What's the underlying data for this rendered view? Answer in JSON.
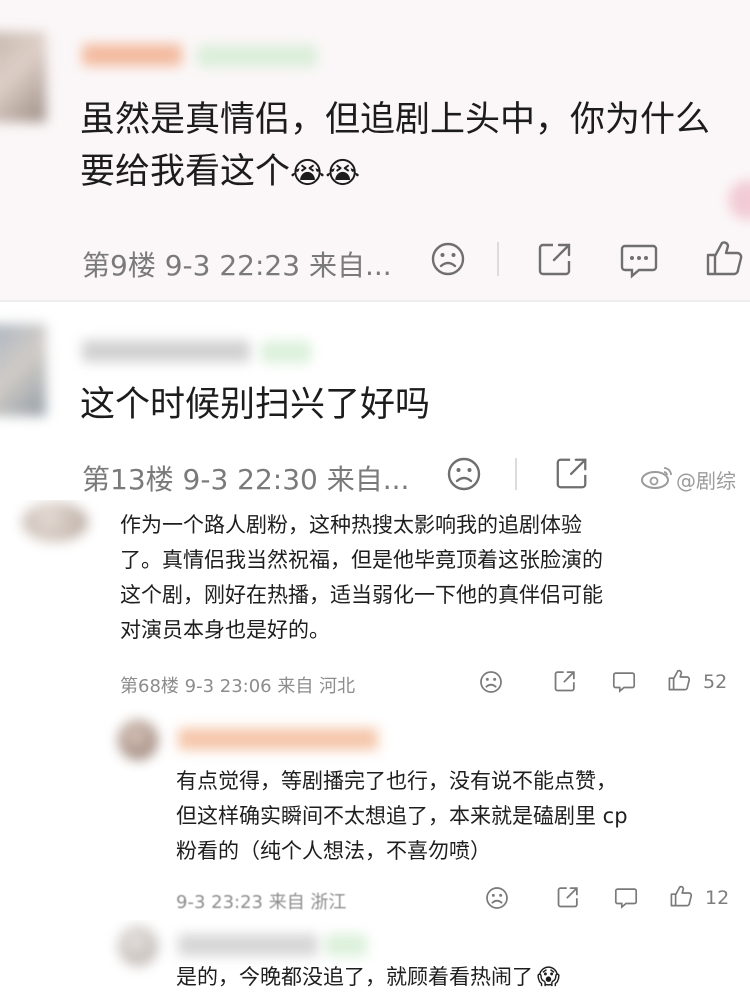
{
  "comment_1": {
    "text_line1": "虽然是真情侣，但追剧上头中，你为什么",
    "text_line2": "要给我看这个",
    "emoji": "😭😭",
    "meta": "第9楼  9-3 22:23  来自..."
  },
  "comment_2": {
    "text": "这个时候别扫兴了好吗",
    "meta": "第13楼  9-3 22:30  来自..."
  },
  "watermark": "@剧综",
  "comment_3": {
    "lines": [
      "作为一个路人剧粉，这种热搜太影响我的追剧体验",
      "了。真情侣我当然祝福，但是他毕竟顶着这张脸演的",
      "这个剧，刚好在热播，适当弱化一下他的真伴侣可能",
      "对演员本身也是好的。"
    ],
    "meta": "第68楼  9-3 23:06  来自 河北",
    "likes": "52"
  },
  "reply_1": {
    "lines": [
      "有点觉得，等剧播完了也行，没有说不能点赞，",
      "但这样确实瞬间不太想追了，本来就是磕剧里 cp",
      "粉看的（纯个人想法，不喜勿喷）"
    ],
    "meta": "9-3 23:23  来自 浙江",
    "likes": "12"
  },
  "reply_2": {
    "text": "是的，今晚都没追了，就顾着看热闹了",
    "emoji": "😱"
  },
  "colors": {
    "text": "#1c1c1c",
    "meta": "#7a7a7a",
    "badge": "#d7efd6",
    "name_blur": "#f2b08f"
  }
}
